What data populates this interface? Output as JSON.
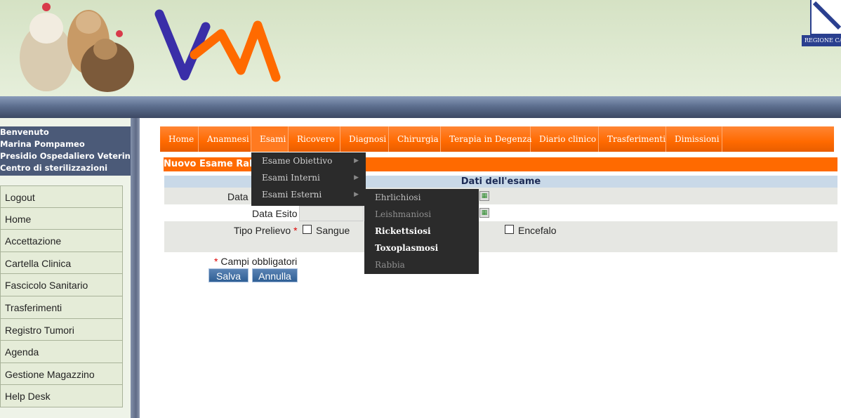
{
  "header": {
    "region_label": "REGIONE CAMPANIA"
  },
  "welcome": {
    "line1": "Benvenuto",
    "line2": "Marina Pompameo",
    "line3": "Presidio Ospedaliero Veterinario",
    "line4": "Centro di sterilizzazioni"
  },
  "sidebar": {
    "items": [
      {
        "label": "Logout"
      },
      {
        "label": "Home"
      },
      {
        "label": "Accettazione"
      },
      {
        "label": "Cartella Clinica"
      },
      {
        "label": "Fascicolo Sanitario"
      },
      {
        "label": "Trasferimenti"
      },
      {
        "label": "Registro Tumori"
      },
      {
        "label": "Agenda"
      },
      {
        "label": "Gestione Magazzino"
      },
      {
        "label": "Help Desk"
      }
    ]
  },
  "topnav": {
    "items": [
      {
        "label": "Home"
      },
      {
        "label": "Anamnesi"
      },
      {
        "label": "Esami"
      },
      {
        "label": "Ricovero"
      },
      {
        "label": "Diagnosi"
      },
      {
        "label": "Chirurgia"
      },
      {
        "label": "Terapia in Degenza"
      },
      {
        "label": "Diario clinico"
      },
      {
        "label": "Trasferimenti"
      },
      {
        "label": "Dimissioni"
      }
    ]
  },
  "dropdown": {
    "items": [
      {
        "label": "Esame Obiettivo"
      },
      {
        "label": "Esami Interni"
      },
      {
        "label": "Esami Esterni"
      }
    ],
    "submenu": [
      {
        "label": "Ehrlichiosi"
      },
      {
        "label": "Leishmaniosi"
      },
      {
        "label": "Rickettsiosi"
      },
      {
        "label": "Toxoplasmosi"
      },
      {
        "label": "Rabbia"
      }
    ]
  },
  "form": {
    "title": "Nuovo Esame Rabbia",
    "section": "Dati dell'esame",
    "field_data_label": "Data",
    "field_esito_label": "Data Esito",
    "field_prelievo_label": "Tipo Prelievo",
    "required_mark": "*",
    "opt_sangue": "Sangue",
    "opt_encefalo": "Encefalo",
    "required_note": "Campi obbligatori",
    "save_label": "Salva",
    "cancel_label": "Annulla"
  },
  "colors": {
    "accent": "#ff6a00",
    "sidebar_dark": "#4b5a78",
    "dropdown_bg": "#2b2b2b"
  }
}
